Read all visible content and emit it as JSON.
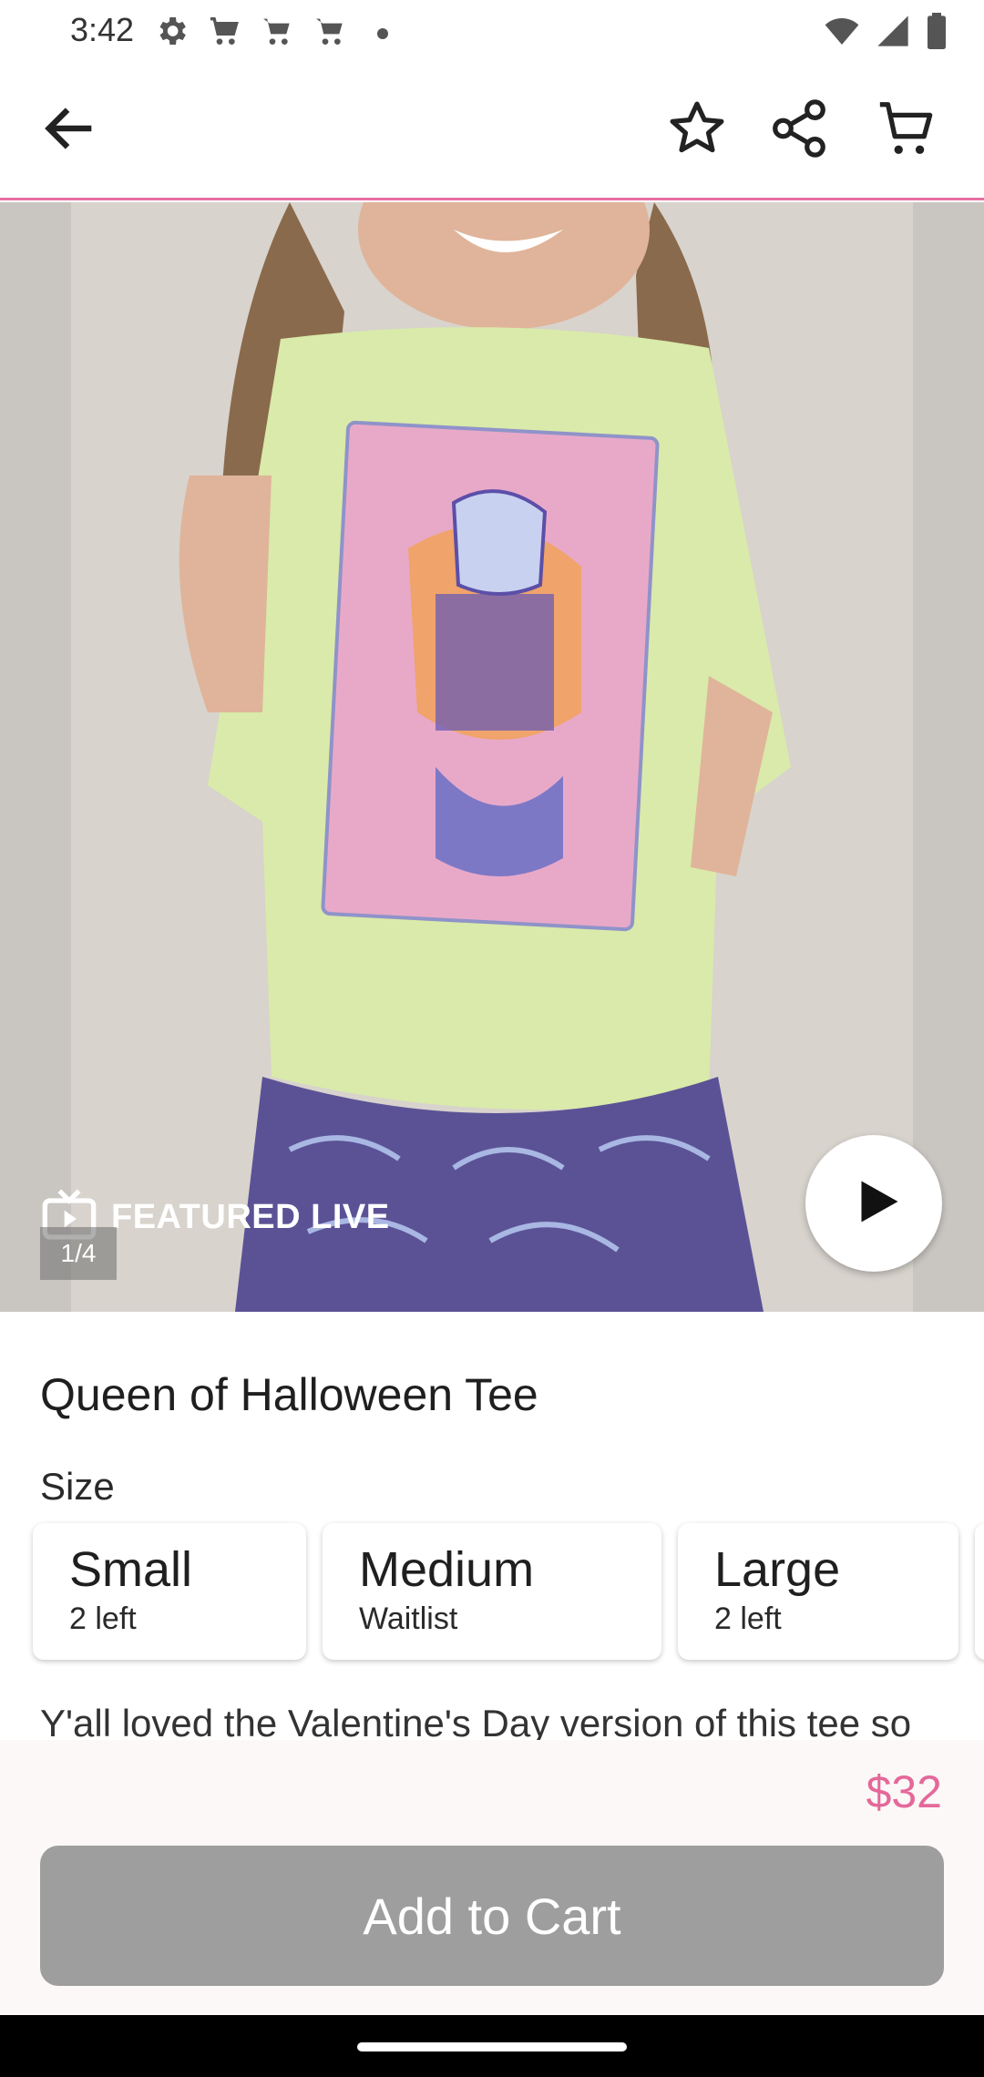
{
  "status_bar": {
    "time": "3:42",
    "left_icons": [
      "gear-icon",
      "cart-icon",
      "cart-icon",
      "cart-icon",
      "dot-icon"
    ],
    "right_icons": [
      "wifi-icon",
      "signal-icon",
      "battery-icon"
    ]
  },
  "app_bar": {
    "icons": [
      "back-arrow-icon",
      "star-outline-icon",
      "share-icon",
      "cart-icon"
    ],
    "accent_color": "#e76fa0"
  },
  "media": {
    "badge_text": "FEATURED LIVE",
    "page_counter": "1/4",
    "play_icon": "play-icon"
  },
  "product": {
    "title": "Queen of Halloween Tee",
    "size_label": "Size",
    "sizes": [
      {
        "name": "Small",
        "stock": "2 left"
      },
      {
        "name": "Medium",
        "stock": "Waitlist"
      },
      {
        "name": "Large",
        "stock": "2 left"
      }
    ],
    "description": "Y'all loved the Valentine's Day version of this tee so"
  },
  "purchase": {
    "price": "$32",
    "price_color": "#e5689a",
    "add_to_cart_label": "Add to Cart",
    "button_color": "#9e9e9e"
  }
}
